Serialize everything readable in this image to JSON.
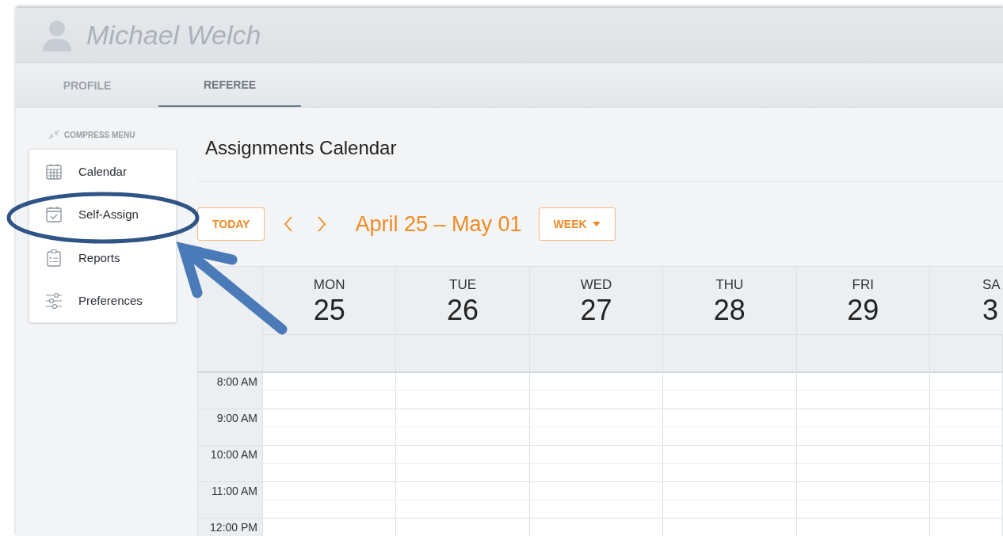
{
  "user": {
    "name": "Michael Welch"
  },
  "tabs": [
    {
      "label": "PROFILE",
      "selected": false
    },
    {
      "label": "REFEREE",
      "selected": true
    }
  ],
  "sidebar": {
    "compress_label": "COMPRESS MENU",
    "items": [
      {
        "label": "Calendar"
      },
      {
        "label": "Self-Assign"
      },
      {
        "label": "Reports"
      },
      {
        "label": "Preferences"
      }
    ]
  },
  "page_title": "Assignments Calendar",
  "toolbar": {
    "today": "TODAY",
    "range": "April 25 – May 01",
    "view": "WEEK"
  },
  "calendar": {
    "days": [
      {
        "name": "MON",
        "date": "25"
      },
      {
        "name": "TUE",
        "date": "26"
      },
      {
        "name": "WED",
        "date": "27"
      },
      {
        "name": "THU",
        "date": "28"
      },
      {
        "name": "FRI",
        "date": "29"
      },
      {
        "name": "SA",
        "date": "3",
        "partial": true
      }
    ],
    "times": [
      "8:00 AM",
      "9:00 AM",
      "10:00 AM",
      "11:00 AM",
      "12:00 PM"
    ]
  }
}
